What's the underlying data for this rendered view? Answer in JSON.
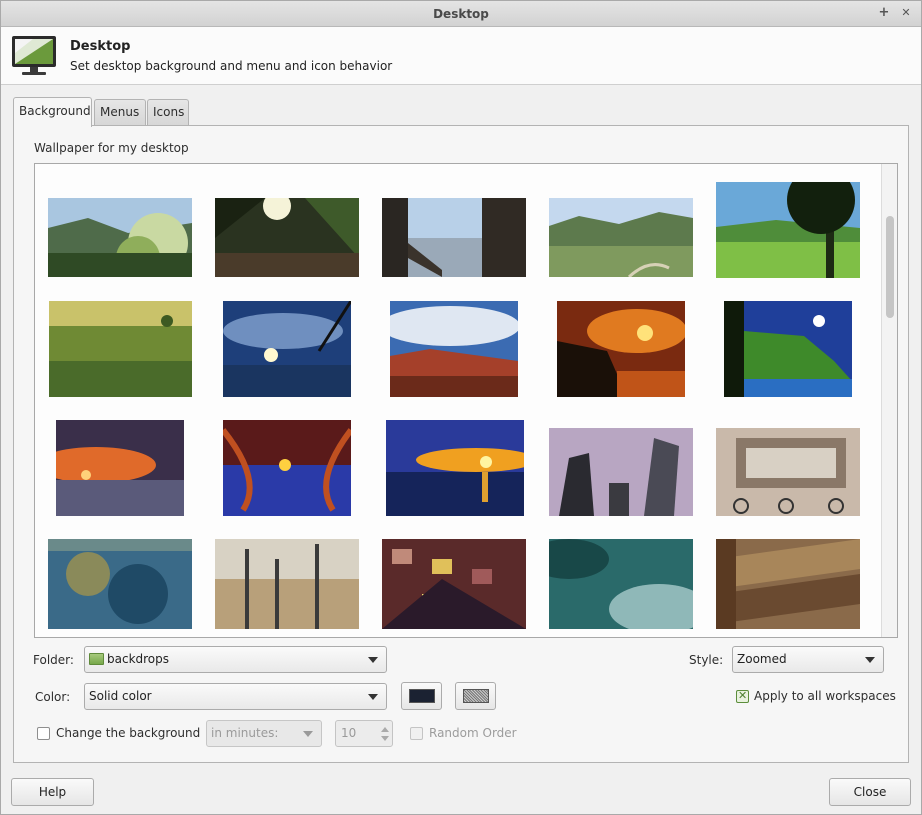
{
  "window": {
    "title": "Desktop",
    "maximize_glyph": "+",
    "close_glyph": "✕"
  },
  "header": {
    "title": "Desktop",
    "subtitle": "Set desktop background and menu and icon behavior",
    "icon": "desktop-monitor-icon"
  },
  "tabs": [
    {
      "label": "Background",
      "active": true
    },
    {
      "label": "Menus",
      "active": false
    },
    {
      "label": "Icons",
      "active": false
    }
  ],
  "background": {
    "wallpaper_label": "Wallpaper for my desktop",
    "thumbnails": [
      "mountain-flowers",
      "forest-sunlight",
      "window-view",
      "green-valley",
      "meadow-tree",
      "grass-field",
      "palm-sunset-clouds",
      "canyon-clouds",
      "fiery-sunset-cliff",
      "coastal-cliff-night",
      "sunset-beach",
      "red-willow-sunset",
      "blue-sunset-water",
      "skyscrapers",
      "bicycles-street",
      "blue-grunge-texture",
      "dry-grass-fence",
      "colored-glass-grid",
      "teal-blur",
      "wooden-wall"
    ],
    "folder_label": "Folder:",
    "folder_value": "backdrops",
    "style_label": "Style:",
    "style_value": "Zoomed",
    "color_label": "Color:",
    "color_value": "Solid color",
    "primary_color": "#1b2232",
    "apply_all_label": "Apply to all workspaces",
    "apply_all_checked": true,
    "change_bg_label": "Change the background",
    "change_bg_checked": false,
    "interval_value": "in minutes:",
    "interval_number": "10",
    "random_order_label": "Random Order"
  },
  "footer": {
    "help_label": "Help",
    "close_label": "Close"
  }
}
